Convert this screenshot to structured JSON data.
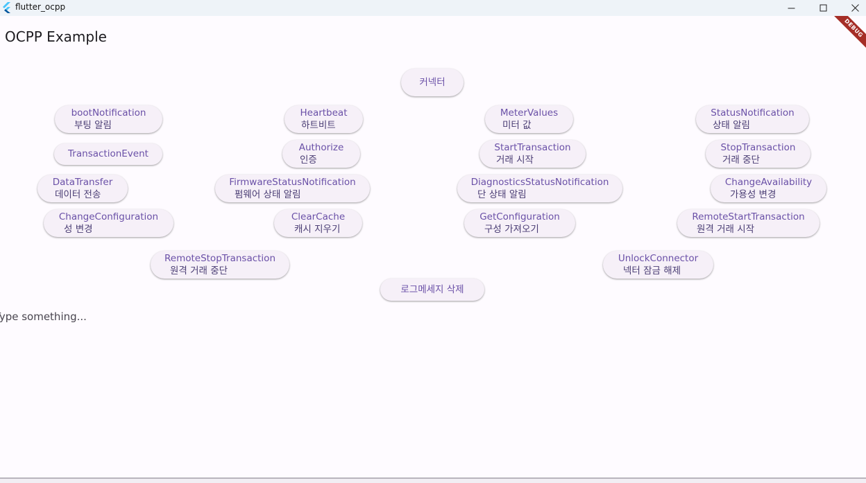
{
  "window": {
    "title": "flutter_ocpp",
    "minimize_icon": "minimize-icon",
    "maximize_icon": "maximize-icon",
    "close_icon": "close-icon"
  },
  "app": {
    "title": "OCPP Example",
    "debug_label": "DEBUG"
  },
  "buttons": {
    "connector": {
      "line1": "커넥터"
    },
    "boot_notification": {
      "line1": "bootNotification",
      "line2": "부팅 알림"
    },
    "heartbeat": {
      "line1": "Heartbeat",
      "line2": "하트비트"
    },
    "meter_values": {
      "line1": "MeterValues",
      "line2": "미터 값"
    },
    "status_notification": {
      "line1": "StatusNotification",
      "line2": "상태 알림"
    },
    "transaction_event": {
      "line1": "TransactionEvent"
    },
    "authorize": {
      "line1": "Authorize",
      "line2": "인증"
    },
    "start_transaction": {
      "line1": "StartTransaction",
      "line2": "거래 시작"
    },
    "stop_transaction": {
      "line1": "StopTransaction",
      "line2": "거래 중단"
    },
    "data_transfer": {
      "line1": "DataTransfer",
      "line2": "데이터 전송"
    },
    "firmware_status_notification": {
      "line1": "FirmwareStatusNotification",
      "line2": "펌웨어 상태 알림"
    },
    "diagnostics_status_notification": {
      "line1": "DiagnosticsStatusNotification",
      "line2": "단 상태 알림"
    },
    "change_availability": {
      "line1": "ChangeAvailability",
      "line2": "가용성 변경"
    },
    "change_configuration": {
      "line1": "ChangeConfiguration",
      "line2": "성 변경"
    },
    "clear_cache": {
      "line1": "ClearCache",
      "line2": "캐시 지우기"
    },
    "get_configuration": {
      "line1": "GetConfiguration",
      "line2": "구성 가져오기"
    },
    "remote_start_transaction": {
      "line1": "RemoteStartTransaction",
      "line2": "원격 거래 시작"
    },
    "remote_stop_transaction": {
      "line1": "RemoteStopTransaction",
      "line2": "원격 거래 중단"
    },
    "unlock_connector": {
      "line1": "UnlockConnector",
      "line2": "넥터 잠금 해제"
    },
    "clear_log": {
      "line1": "로그메세지 삭제"
    }
  },
  "input": {
    "placeholder": "Type something...",
    "value": ""
  },
  "colors": {
    "button_text": "#6a50a7",
    "button_bg": "#f6f0f8",
    "debug_banner": "#a52e27"
  }
}
